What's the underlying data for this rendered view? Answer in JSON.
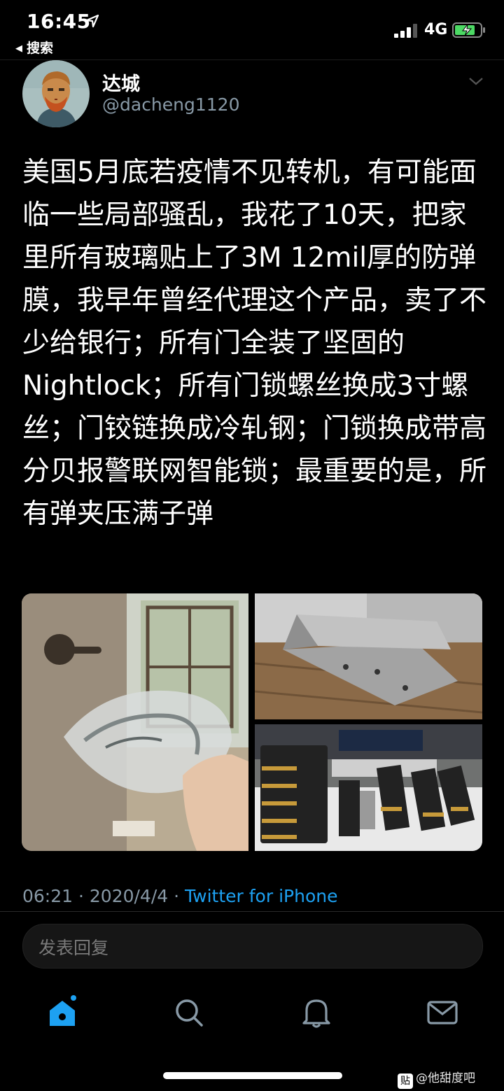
{
  "status_bar": {
    "time": "16:45",
    "back_label": "搜索",
    "network": "4G"
  },
  "author": {
    "name": "达城",
    "handle": "@dacheng1120"
  },
  "tweet": {
    "text": "美国5月底若疫情不见转机，有可能面临一些局部骚乱，我花了10天，把家里所有玻璃贴上了3M 12mil厚的防弹膜，我早年曾经代理这个产品，卖了不少给银行；所有门全装了坚固的Nightlock；所有门锁螺丝换成3寸螺丝；门铰链换成冷轧钢；门锁换成带高分贝报警联网智能锁；最重要的是，所有弹夹压满子弹"
  },
  "meta": {
    "time": "06:21",
    "date": "2020/4/4",
    "separator": " · ",
    "source": "Twitter for iPhone"
  },
  "reply": {
    "placeholder": "发表回复"
  },
  "tabs": [
    {
      "icon": "home-icon"
    },
    {
      "icon": "search-icon"
    },
    {
      "icon": "bell-icon"
    },
    {
      "icon": "mail-icon"
    }
  ],
  "watermark": {
    "icon_char": "贴",
    "text": "@他甜度吧"
  },
  "colors": {
    "background": "#000000",
    "accent": "#1da1f2",
    "secondary_text": "#8899a6"
  }
}
